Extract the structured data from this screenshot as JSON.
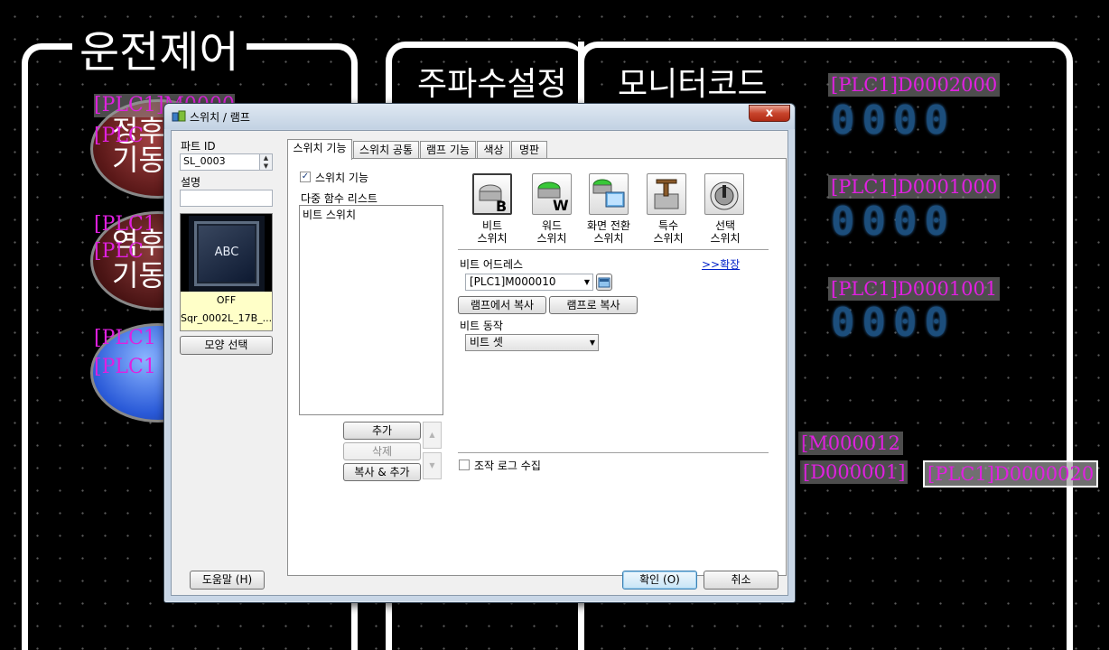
{
  "canvas": {
    "frame_titles": {
      "left": "운전제어",
      "frequency": "주파수설정",
      "monitor": "모니터코드"
    },
    "lamps": [
      {
        "label_top": "[PLC1]M0000",
        "text1": "정후",
        "label_mid": "[PLC",
        "text2": "기동"
      },
      {
        "label_top": "[PLC1",
        "text1": "역후",
        "label_mid": "[PLC",
        "text2": "기동"
      },
      {
        "label_top": "[PLC1",
        "label_mid": "[PLC1"
      }
    ],
    "monitor_labels": [
      "[PLC1]D0002000",
      "[PLC1]D0001000",
      "[PLC1]D0001001"
    ],
    "monitor_digits": "0000",
    "bottom_labels": {
      "m": "[M000012",
      "d": "[D000001]",
      "plc": "[PLC1]D0000020"
    }
  },
  "dialog": {
    "title": "스위치 / 램프",
    "close_label": "x",
    "part_id_label": "파트 ID",
    "part_id_value": "SL_0003",
    "description_label": "설명",
    "description_value": "",
    "preview": {
      "button_text": "ABC",
      "state": "OFF",
      "shape_name": "Sqr_0002L_17B_..."
    },
    "shape_select_label": "모양 선택",
    "tabs": [
      "스위치 기능",
      "스위치 공통",
      "램프 기능",
      "색상",
      "명판"
    ],
    "switch_function_label": "스위치 기능",
    "switch_function_checked": true,
    "multi_function_list_label": "다중 함수 리스트",
    "multi_function_items": [
      "비트 스위치"
    ],
    "list_buttons": {
      "add": "추가",
      "delete": "삭제",
      "copy_add": "복사 & 추가"
    },
    "switch_types": [
      {
        "icon": "bit-switch-icon",
        "line1": "비트",
        "line2": "스위치"
      },
      {
        "icon": "word-switch-icon",
        "line1": "워드",
        "line2": "스위치"
      },
      {
        "icon": "screen-change-switch-icon",
        "line1": "화면 전환",
        "line2": "스위치"
      },
      {
        "icon": "special-switch-icon",
        "line1": "특수",
        "line2": "스위치"
      },
      {
        "icon": "select-switch-icon",
        "line1": "선택",
        "line2": "스위치"
      }
    ],
    "bit_address_label": "비트 어드레스",
    "expand_label": ">>확장",
    "bit_address_value": "[PLC1]M000010",
    "copy_from_lamp": "램프에서 복사",
    "copy_to_lamp": "램프로 복사",
    "bit_action_label": "비트 동작",
    "bit_action_value": "비트 셋",
    "op_log_label": "조작 로그 수집",
    "op_log_checked": false,
    "help_label": "도움말 (H)",
    "ok_label": "확인 (O)",
    "cancel_label": "취소",
    "colors": {
      "plc_label": "#e020e0",
      "segment_digit": "#1c4e7c",
      "dialog_frame": "#c8d6e6",
      "close_button": "#c8442c"
    }
  }
}
